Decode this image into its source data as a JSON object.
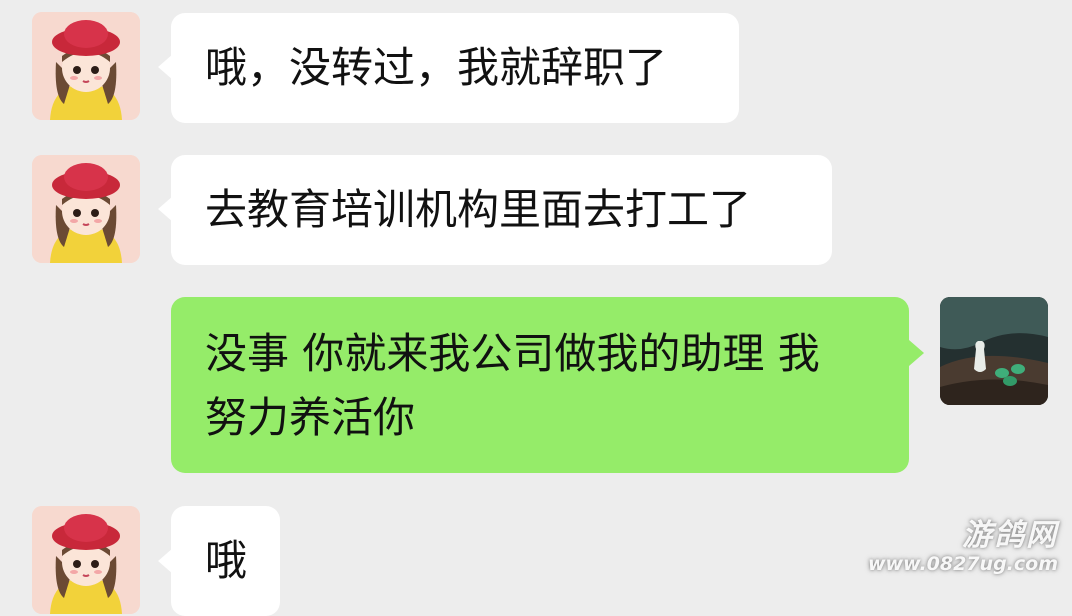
{
  "conversation": {
    "messages": [
      {
        "direction": "incoming",
        "sender_avatar": "girl-red-hat-avatar",
        "text": "哦，没转过，我就辞职了"
      },
      {
        "direction": "incoming",
        "sender_avatar": "girl-red-hat-avatar",
        "text": "去教育培训机构里面去打工了"
      },
      {
        "direction": "outgoing",
        "sender_avatar": "landscape-cups-avatar",
        "text_line1": "没事 你就来我公司做我的助理 我",
        "text_line2": "努力养活你"
      },
      {
        "direction": "incoming",
        "sender_avatar": "girl-red-hat-avatar",
        "text": "哦"
      }
    ]
  },
  "watermark": {
    "name": "游鸽网",
    "url": "www.0827ug.com"
  },
  "colors": {
    "background": "#ededed",
    "incoming_bubble": "#ffffff",
    "outgoing_bubble": "#95ec69",
    "text": "#111111"
  }
}
